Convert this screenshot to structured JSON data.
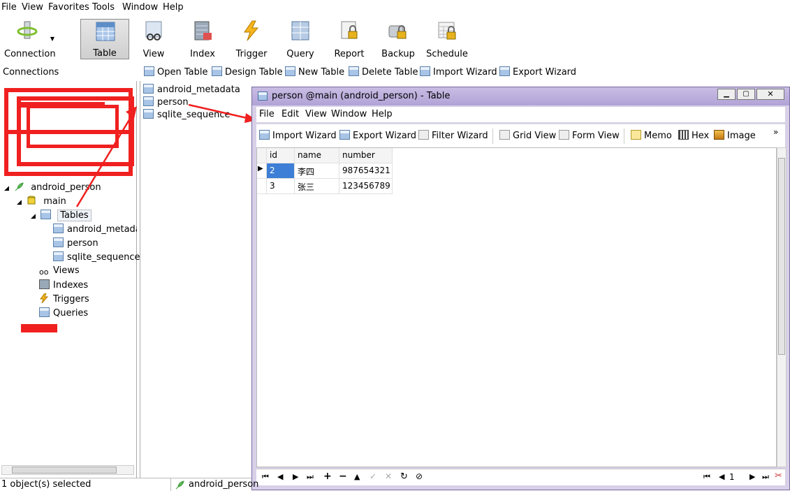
{
  "menubar": [
    "File",
    "View",
    "Favorites",
    "Tools",
    "Window",
    "Help"
  ],
  "toolbar": {
    "connection": "Connection",
    "items": [
      "Table",
      "View",
      "Index",
      "Trigger",
      "Query",
      "Report",
      "Backup",
      "Schedule"
    ]
  },
  "connections_header": "Connections",
  "subtoolbar": [
    "Open Table",
    "Design Table",
    "New Table",
    "Delete Table",
    "Import Wizard",
    "Export Wizard"
  ],
  "tree": {
    "db": "android_person",
    "schema": "main",
    "tables_folder": "Tables",
    "tables": [
      "android_metadat",
      "person",
      "sqlite_sequence"
    ],
    "folders": [
      "Views",
      "Indexes",
      "Triggers",
      "Queries"
    ]
  },
  "objects": [
    "android_metadata",
    "person",
    "sqlite_sequence"
  ],
  "table_window": {
    "title": "person @main (android_person) - Table",
    "menu": [
      "File",
      "Edit",
      "View",
      "Window",
      "Help"
    ],
    "tools": [
      "Import Wizard",
      "Export Wizard",
      "Filter Wizard",
      "Grid View",
      "Form View",
      "Memo",
      "Hex",
      "Image"
    ],
    "columns": [
      "id",
      "name",
      "number"
    ],
    "rows": [
      [
        "2",
        "李四",
        "987654321"
      ],
      [
        "3",
        "张三",
        "123456789"
      ]
    ],
    "page": "1"
  },
  "status": {
    "selected": "1 object(s) selected",
    "db": "android_person"
  },
  "colors": {
    "redact": "#f02020",
    "accent": "#3d7fd6",
    "window": "#b9acdd"
  }
}
